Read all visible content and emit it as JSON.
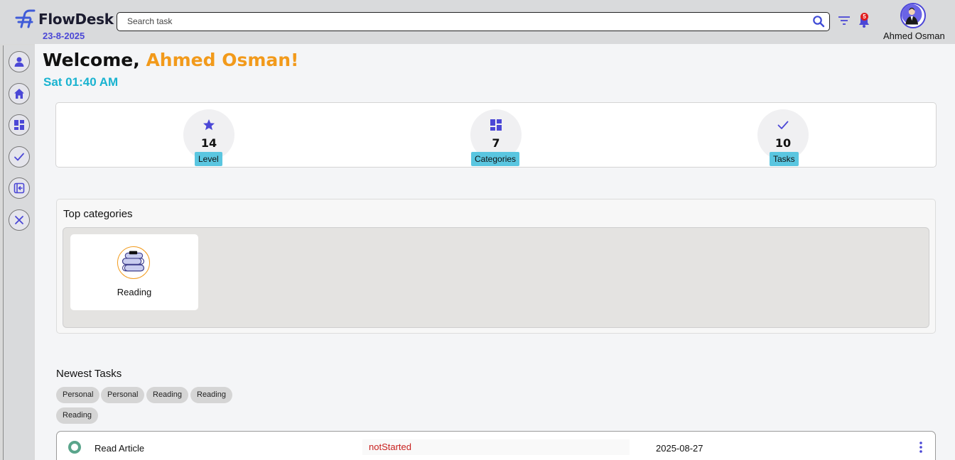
{
  "header": {
    "brand_name": "FlowDesk",
    "date": "23-8-2025",
    "search_placeholder": "Search task",
    "notification_count": "5",
    "user_name": "Ahmed Osman"
  },
  "sidebar": {
    "items": [
      {
        "icon": "profile-icon"
      },
      {
        "icon": "home-icon"
      },
      {
        "icon": "dashboard-icon"
      },
      {
        "icon": "check-icon"
      },
      {
        "icon": "logout-icon"
      },
      {
        "icon": "close-icon"
      }
    ]
  },
  "welcome": {
    "greeting": "Welcome,",
    "name": "Ahmed Osman!",
    "time": "Sat 01:40 AM"
  },
  "stats": [
    {
      "icon": "star-icon",
      "value": "14",
      "label": "Level"
    },
    {
      "icon": "grid-icon",
      "value": "7",
      "label": "Categories"
    },
    {
      "icon": "check-icon",
      "value": "10",
      "label": "Tasks"
    }
  ],
  "top_categories": {
    "title": "Top categories",
    "items": [
      {
        "icon": "books-icon",
        "label": "Reading"
      }
    ]
  },
  "newest_tasks": {
    "title": "Newest Tasks",
    "chips": [
      "Personal",
      "Personal",
      "Reading",
      "Reading",
      "Reading"
    ],
    "tasks": [
      {
        "title": "Read Article",
        "status": "notStarted",
        "date": "2025-08-27"
      }
    ]
  },
  "colors": {
    "accent": "#4b47d6",
    "name_orange": "#f29a1b",
    "time_cyan": "#19b3d0",
    "label_cyan": "#5ac6e0",
    "status_red": "#c8201e"
  }
}
